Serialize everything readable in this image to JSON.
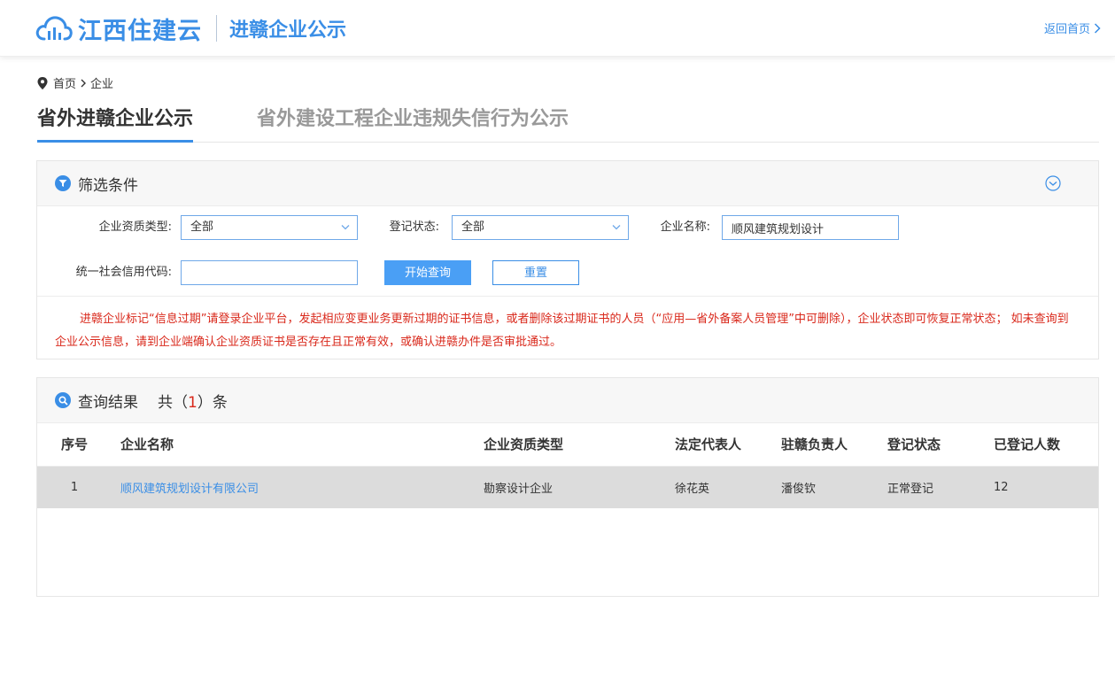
{
  "header": {
    "logo_text": "江西住建云",
    "subtitle": "进赣企业公示",
    "back_home": "返回首页"
  },
  "breadcrumb": {
    "home": "首页",
    "current": "企业"
  },
  "tabs": [
    {
      "label": "省外进赣企业公示",
      "active": true
    },
    {
      "label": "省外建设工程企业违规失信行为公示",
      "active": false
    }
  ],
  "filter": {
    "title": "筛选条件",
    "qualification_type_label": "企业资质类型:",
    "qualification_type_value": "全部",
    "status_label": "登记状态:",
    "status_value": "全部",
    "company_name_label": "企业名称:",
    "company_name_value": "顺风建筑规划设计",
    "credit_code_label": "统一社会信用代码:",
    "credit_code_value": "",
    "search_button": "开始查询",
    "reset_button": "重置",
    "notice": "进赣企业标记“信息过期”请登录企业平台，发起相应变更业务更新过期的证书信息，或者删除该过期证书的人员（“应用—省外备案人员管理”中可删除），企业状态即可恢复正常状态；  如未查询到企业公示信息，请到企业端确认企业资质证书是否存在且正常有效，或确认进赣办件是否审批通过。"
  },
  "results": {
    "title": "查询结果",
    "count_prefix": "共（",
    "count": "1",
    "count_suffix": "）条",
    "columns": [
      "序号",
      "企业名称",
      "企业资质类型",
      "法定代表人",
      "驻赣负责人",
      "登记状态",
      "已登记人数"
    ],
    "rows": [
      {
        "no": "1",
        "name": "顺风建筑规划设计有限公司",
        "qualification": "勘察设计企业",
        "legal_rep": "徐花英",
        "local_manager": "潘俊钦",
        "status": "正常登记",
        "registered_count": "12"
      }
    ]
  },
  "colors": {
    "accent": "#3a8ee6",
    "button": "#4a9ff5",
    "notice": "#d9281b",
    "row_highlight": "#dcdcdc"
  }
}
